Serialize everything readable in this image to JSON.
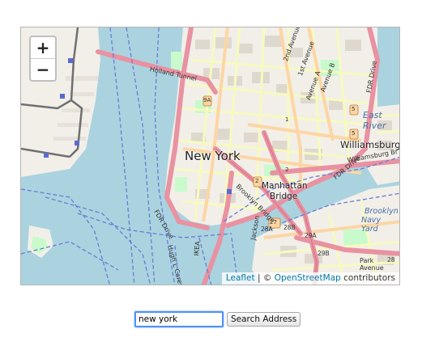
{
  "map": {
    "labels": {
      "city": "New York",
      "williamsburg": "Williamsburg",
      "east_river": "East River",
      "manhattan_bridge_1": "Manhattan",
      "manhattan_bridge_2": "Bridge",
      "brooklyn_navy_1": "Brooklyn",
      "brooklyn_navy_2": "Navy Yard",
      "holland_tunnel": "Holland Tunnel",
      "second_ave": "2nd Avenue",
      "first_ave": "1st Avenue",
      "avenue_a": "Avenue A",
      "avenue_b": "Avenue B",
      "fdr_drive_1": "FDR Drive",
      "fdr_drive_2": "FDR Drive",
      "fdr_drive_3": "FDR Drive",
      "williamsburg_bridge": "Williamsburg Br",
      "brooklyn_bridge": "Brooklyn Bridge",
      "park_avenue": "Park Avenue",
      "hugh_carey": "Hugh L Carey",
      "jackson": "Jackson",
      "ikea": "IKEA",
      "route_9a": "9A",
      "route_1": "1",
      "route_5": "5",
      "route_5b": "5",
      "route_2": "2",
      "route_2b": "2",
      "route_27": "27",
      "route_28a": "28A",
      "route_28b": "28B",
      "route_29a": "29A",
      "route_29b": "29B",
      "route_28": "28"
    }
  },
  "zoom": {
    "in_label": "+",
    "out_label": "−"
  },
  "attribution": {
    "leaflet": "Leaflet",
    "sep": "| ©",
    "osm": "OpenStreetMap",
    "contributors": "contributors"
  },
  "search": {
    "value": "new york",
    "button_label": "Search Address"
  },
  "colors": {
    "water": "#aad3df",
    "land": "#f2efe9",
    "park": "#c8facc",
    "motorway": "#e892a2",
    "primary": "#fcd6a4",
    "secondary": "#f7fabf",
    "ferry": "#6b7bd6",
    "rail": "#707070",
    "link": "#0078a8"
  }
}
